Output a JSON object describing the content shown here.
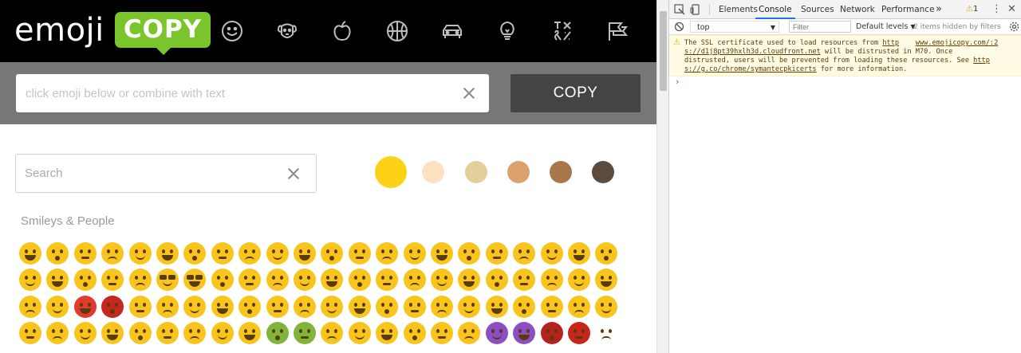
{
  "site": {
    "logo": {
      "word": "emoji",
      "badge": "COPY"
    },
    "categories": [
      {
        "icon": "smiley-icon",
        "label": "smileys"
      },
      {
        "icon": "dog-icon",
        "label": "animals"
      },
      {
        "icon": "apple-icon",
        "label": "food"
      },
      {
        "icon": "basketball-icon",
        "label": "activities"
      },
      {
        "icon": "car-icon",
        "label": "travel"
      },
      {
        "icon": "lightbulb-icon",
        "label": "objects"
      },
      {
        "icon": "symbols-icon",
        "label": "symbols"
      },
      {
        "icon": "flags-icon",
        "label": "flags"
      }
    ],
    "compose": {
      "placeholder": "click emoji below or combine with text",
      "value": ""
    },
    "copy_label": "COPY",
    "search": {
      "placeholder": "Search",
      "value": ""
    },
    "skin_tones": [
      "#fcd116",
      "#fde1c2",
      "#e2cf9c",
      "#dda16d",
      "#a9774a",
      "#5d4b3e"
    ],
    "section_title": "Smileys & People",
    "emoji_rows": [
      [
        "😀",
        "😃",
        "😄",
        "😁",
        "😆",
        "😅",
        "😂",
        "🤣",
        "☺️",
        "😊",
        "😇",
        "🙂",
        "🙃",
        "😉",
        "😌",
        "😍",
        "😘",
        "😗",
        "😙",
        "😚",
        "😋",
        "😛"
      ],
      [
        "😝",
        "😜",
        "🤪",
        "🤨",
        "🧐",
        "🤓",
        "😎",
        "🤩",
        "😏",
        "😒",
        "😞",
        "😔",
        "😟",
        "😕",
        "🙁",
        "☹️",
        "😣",
        "😖",
        "😫",
        "😩",
        "😢",
        "😭"
      ],
      [
        "😤",
        "😠",
        "😡",
        "🤬",
        "🤯",
        "😳",
        "😱",
        "😨",
        "😰",
        "😥",
        "😓",
        "🤗",
        "🤔",
        "🤭",
        "🤫",
        "🤥",
        "😶",
        "😐",
        "😑",
        "😬",
        "🙄",
        "😯"
      ],
      [
        "😦",
        "😧",
        "😮",
        "😲",
        "😴",
        "🤤",
        "😪",
        "😵",
        "🤐",
        "🤢",
        "🤮",
        "🤧",
        "😷",
        "🤒",
        "🤕",
        "🤑",
        "🤠",
        "😈",
        "👿",
        "👹",
        "👺",
        "🤡"
      ]
    ]
  },
  "devtools": {
    "tabs": [
      "Elements",
      "Console",
      "Sources",
      "Network",
      "Performance"
    ],
    "active_tab": "Console",
    "more": "»",
    "warning_count": "1",
    "context": "top",
    "filter_placeholder": "Filter",
    "levels": "Default levels",
    "hidden": "2 items hidden by filters",
    "warning": {
      "l1a": "The SSL certificate used to load resources from ",
      "l1link": "http",
      "l1b": "    ",
      "l1src": "www.emojicopy.com/:2",
      "l2link": "s://d1j8pt39hxlh3d.cloudfront.net",
      "l2b": " will be distrusted in M70. Once",
      "l3": "distrusted, users will be prevented from loading these resources. See ",
      "l3link": "http",
      "l4link": "s://g.co/chrome/symantecpkicerts",
      "l4b": " for more information."
    },
    "prompt": "›"
  }
}
